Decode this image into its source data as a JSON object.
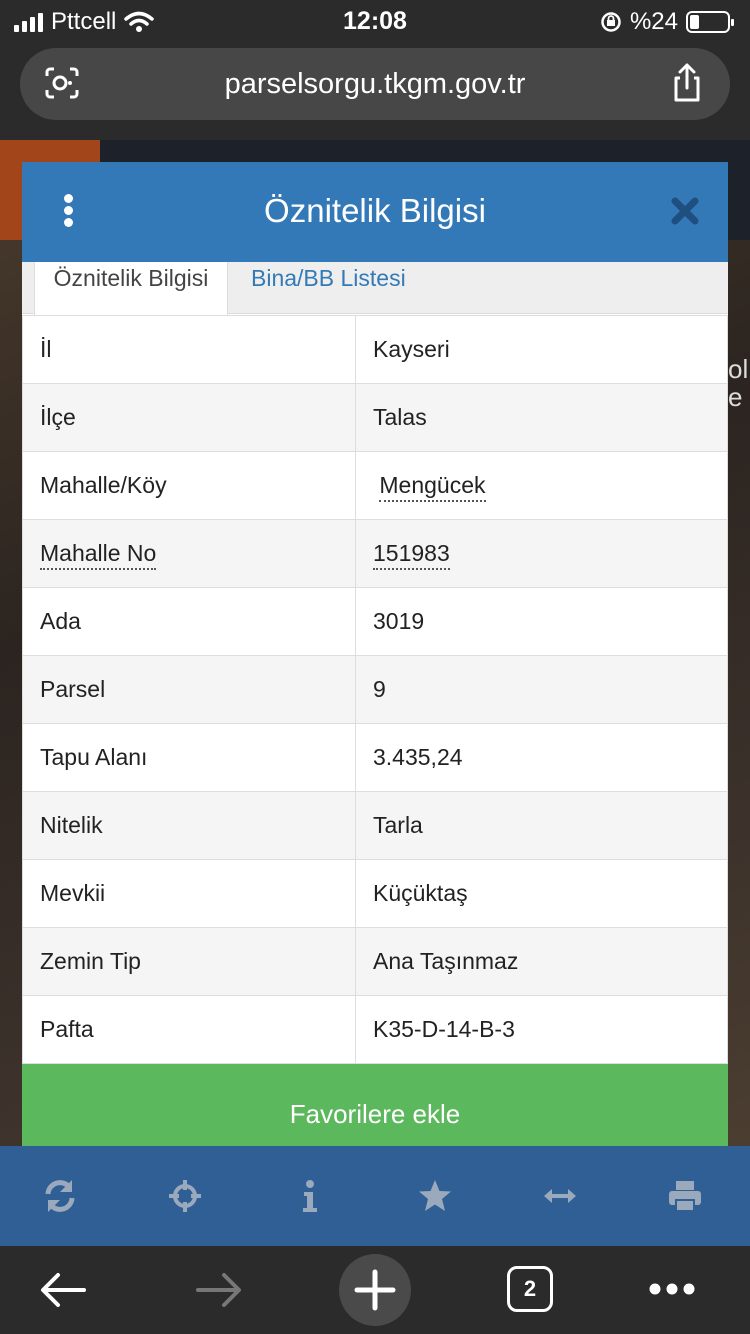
{
  "status_bar": {
    "carrier": "Pttcell",
    "time": "12:08",
    "battery": "%24"
  },
  "browser": {
    "url": "parselsorgu.tkgm.gov.tr",
    "open_tabs": "2"
  },
  "map": {
    "edge_text": "ol e"
  },
  "modal": {
    "title": "Öznitelik Bilgisi",
    "tabs": [
      {
        "label": "Öznitelik Bilgisi",
        "active": true
      },
      {
        "label": "Bina/BB Listesi",
        "active": false
      }
    ],
    "rows": [
      {
        "key": "İl",
        "value": "Kayseri"
      },
      {
        "key": "İlçe",
        "value": "Talas"
      },
      {
        "key": "Mahalle/Köy",
        "value": "Mengücek"
      },
      {
        "key": "Mahalle No",
        "value": "151983"
      },
      {
        "key": "Ada",
        "value": "3019"
      },
      {
        "key": "Parsel",
        "value": "9"
      },
      {
        "key": "Tapu Alanı",
        "value": "3.435,24"
      },
      {
        "key": "Nitelik",
        "value": "Tarla"
      },
      {
        "key": "Mevkii",
        "value": "Küçüktaş"
      },
      {
        "key": "Zemin Tip",
        "value": "Ana Taşınmaz"
      },
      {
        "key": "Pafta",
        "value": "K35-D-14-B-3"
      }
    ],
    "favorite_button": "Favorilere ekle"
  },
  "map_toolbar": {
    "icons": [
      "refresh-icon",
      "crosshair-icon",
      "info-icon",
      "star-icon",
      "measure-icon",
      "print-icon"
    ]
  },
  "bottom_bar": {
    "icons": [
      "back-arrow-icon",
      "forward-arrow-icon",
      "new-tab-plus-icon",
      "tabs-icon",
      "more-icon"
    ]
  },
  "colors": {
    "header_blue": "#3379b8",
    "tab_link_blue": "#337ab7",
    "favorite_green": "#5cb85c",
    "map_toolbar_blue": "#2f5f95"
  }
}
